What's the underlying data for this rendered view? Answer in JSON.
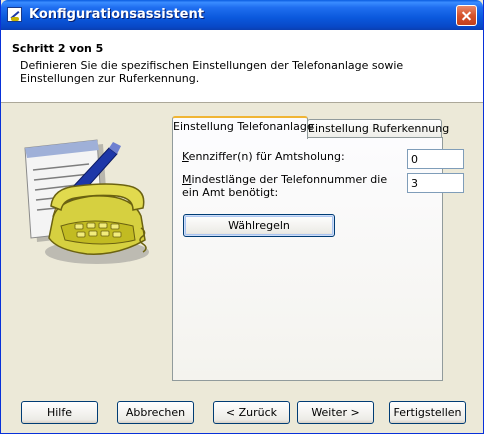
{
  "window": {
    "title": "Konfigurationsassistent"
  },
  "header": {
    "step": "Schritt 2 von 5",
    "description": "Definieren Sie die spezifischen Einstellungen der Telefonanlage sowie Einstellungen zur Ruferkennung."
  },
  "tabs": [
    {
      "label": "Einstellung Telefonanlage",
      "active": true
    },
    {
      "label": "Einstellung Ruferkennung",
      "active": false
    }
  ],
  "form": {
    "amtsholung_label_underlined": "K",
    "amtsholung_label_rest": "ennziffer(n) für Amtsholung:",
    "amtsholung_value": "0",
    "mindestlaenge_label_underlined": "M",
    "mindestlaenge_label_rest": "indestlänge der Telefonnummer die ein Amt benötigt:",
    "mindestlaenge_value": "3",
    "waehlregeln_button": "Wählregeln"
  },
  "footer": {
    "hilfe": "Hilfe",
    "abbrechen": "Abbrechen",
    "zurueck": "< Zurück",
    "weiter": "Weiter >",
    "fertigstellen": "Fertigstellen"
  },
  "icons": {
    "app": "wizard-app-icon",
    "illustration": "telephone-notepad-pen-icon"
  }
}
